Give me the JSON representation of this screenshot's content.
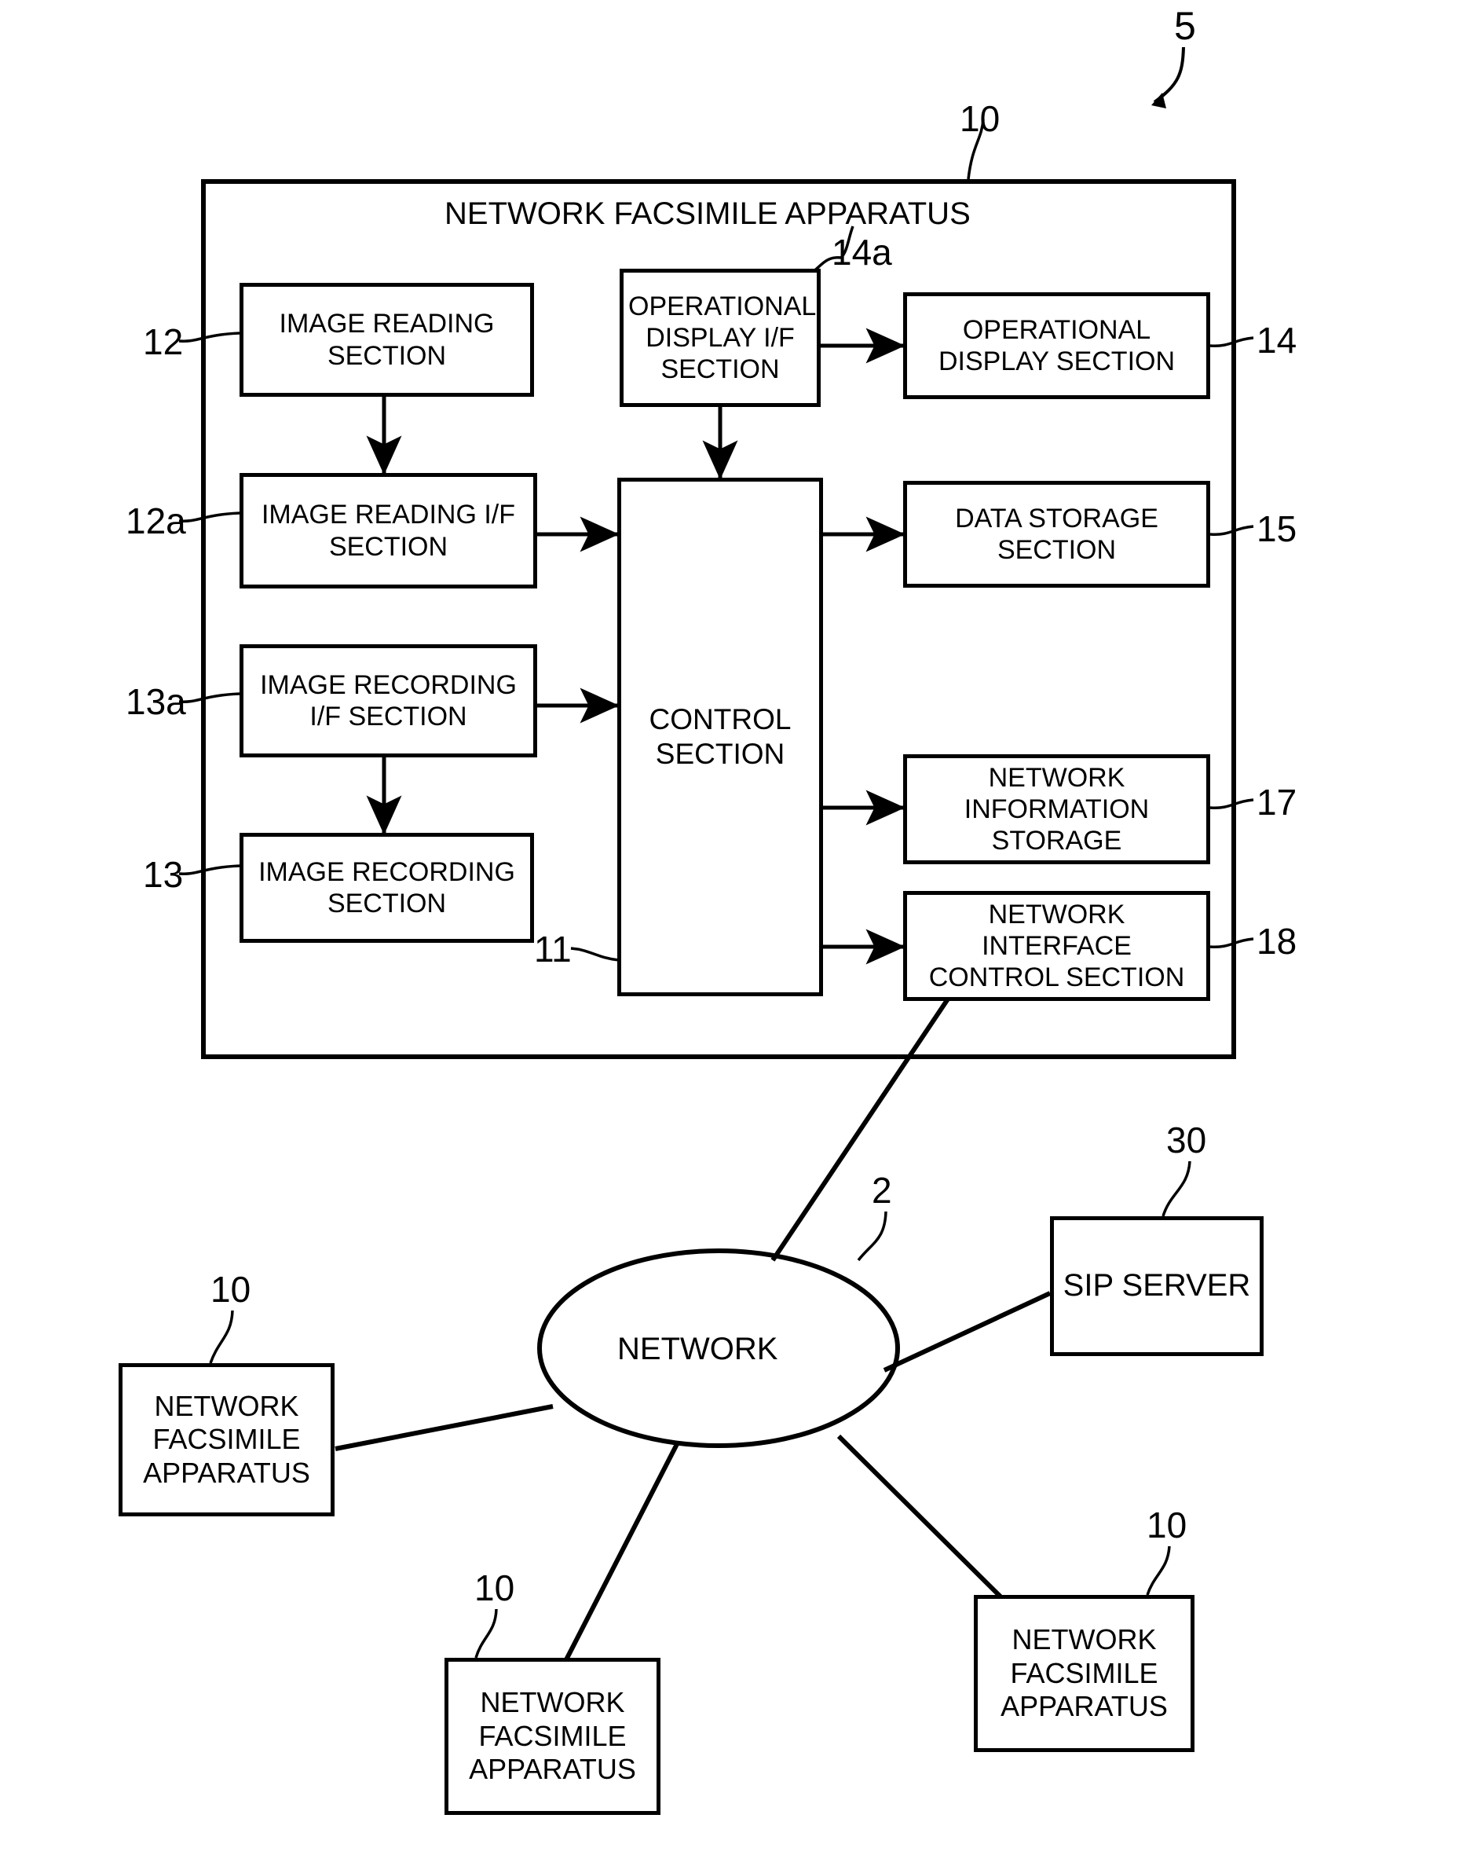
{
  "figure": {
    "title": "NETWORK FACSIMILE APPARATUS",
    "ref_system": "5",
    "ref_apparatus_top": "10"
  },
  "apparatus": {
    "title": "NETWORK FACSIMILE APPARATUS",
    "blocks": [
      {
        "id": "image-reading-section",
        "label": "IMAGE READING\nSECTION",
        "ref": "12"
      },
      {
        "id": "image-reading-if-section",
        "label": "IMAGE READING I/F\nSECTION",
        "ref": "12a"
      },
      {
        "id": "image-recording-if-section",
        "label": "IMAGE RECORDING\nI/F SECTION",
        "ref": "13a"
      },
      {
        "id": "image-recording-section",
        "label": "IMAGE RECORDING\nSECTION",
        "ref": "13"
      },
      {
        "id": "operational-display-if-section",
        "label": "OPERATIONAL\nDISPLAY I/F\nSECTION",
        "ref": "14a"
      },
      {
        "id": "control-section",
        "label": "CONTROL\nSECTION",
        "ref": "11"
      },
      {
        "id": "operational-display-section",
        "label": "OPERATIONAL\nDISPLAY SECTION",
        "ref": "14"
      },
      {
        "id": "data-storage-section",
        "label": "DATA STORAGE\nSECTION",
        "ref": "15"
      },
      {
        "id": "network-information-storage",
        "label": "NETWORK\nINFORMATION\nSTORAGE",
        "ref": "17"
      },
      {
        "id": "network-interface-control-section",
        "label": "NETWORK\nINTERFACE\nCONTROL SECTION",
        "ref": "18"
      }
    ]
  },
  "network": {
    "cloud_label": "NETWORK",
    "cloud_ref": "2",
    "nodes": [
      {
        "id": "sip-server",
        "label": "SIP SERVER",
        "ref": "30"
      },
      {
        "id": "fax-left",
        "label": "NETWORK\nFACSIMILE\nAPPARATUS",
        "ref": "10"
      },
      {
        "id": "fax-bottom-center",
        "label": "NETWORK\nFACSIMILE\nAPPARATUS",
        "ref": "10"
      },
      {
        "id": "fax-bottom-right",
        "label": "NETWORK\nFACSIMILE\nAPPARATUS",
        "ref": "10"
      }
    ]
  },
  "colors": {
    "line": "#000000",
    "background": "#ffffff"
  }
}
